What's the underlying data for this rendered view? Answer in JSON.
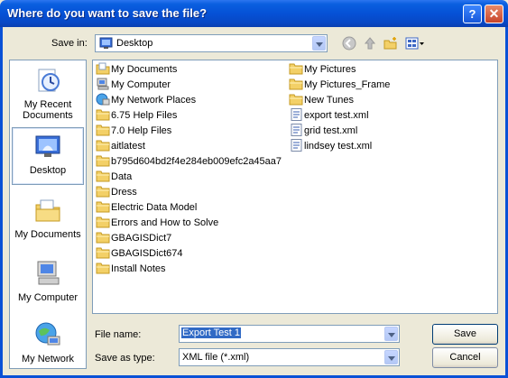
{
  "window": {
    "title": "Where do you want to save the file?",
    "help_label": "?",
    "close_label": "✕"
  },
  "toolbar": {
    "save_in_label": "Save in:",
    "save_in_value": "Desktop",
    "tools": [
      "back-icon",
      "up-folder-icon",
      "new-folder-icon",
      "views-menu-icon"
    ]
  },
  "places": [
    {
      "label_lines": [
        "My Recent",
        "Documents"
      ],
      "icon": "recent-documents-icon"
    },
    {
      "label_lines": [
        "Desktop"
      ],
      "icon": "desktop-icon",
      "selected": true
    },
    {
      "label_lines": [
        "My Documents"
      ],
      "icon": "my-documents-icon"
    },
    {
      "label_lines": [
        "My Computer"
      ],
      "icon": "my-computer-icon"
    },
    {
      "label_lines": [
        "My Network"
      ],
      "icon": "my-network-icon"
    }
  ],
  "files": {
    "col1": [
      {
        "name": "My Documents",
        "icon": "my-documents-icon"
      },
      {
        "name": "My Computer",
        "icon": "my-computer-icon"
      },
      {
        "name": "My Network Places",
        "icon": "network-places-icon"
      },
      {
        "name": "6.75 Help Files",
        "icon": "folder-icon"
      },
      {
        "name": "7.0 Help Files",
        "icon": "folder-icon"
      },
      {
        "name": "aitlatest",
        "icon": "folder-icon"
      },
      {
        "name": "b795d604bd2f4e284eb009efc2a45aa7",
        "icon": "folder-icon"
      },
      {
        "name": "Data",
        "icon": "folder-icon"
      },
      {
        "name": "Dress",
        "icon": "folder-icon"
      },
      {
        "name": "Electric Data Model",
        "icon": "folder-icon"
      },
      {
        "name": "Errors and How to Solve",
        "icon": "folder-icon"
      },
      {
        "name": "GBAGISDict7",
        "icon": "folder-icon"
      },
      {
        "name": "GBAGISDict674",
        "icon": "folder-icon"
      },
      {
        "name": "Install Notes",
        "icon": "folder-icon"
      }
    ],
    "col2": [
      {
        "name": "My Pictures",
        "icon": "folder-icon"
      },
      {
        "name": "My Pictures_Frame",
        "icon": "folder-icon"
      },
      {
        "name": "New Tunes",
        "icon": "folder-icon"
      },
      {
        "name": "export test.xml",
        "icon": "xml-file-icon"
      },
      {
        "name": "grid test.xml",
        "icon": "xml-file-icon"
      },
      {
        "name": "lindsey test.xml",
        "icon": "xml-file-icon"
      }
    ]
  },
  "form": {
    "file_name_label": "File name:",
    "file_name_value": "Export Test 1",
    "save_as_type_label": "Save as type:",
    "save_as_type_value": "XML file (*.xml)"
  },
  "buttons": {
    "save": "Save",
    "cancel": "Cancel"
  }
}
